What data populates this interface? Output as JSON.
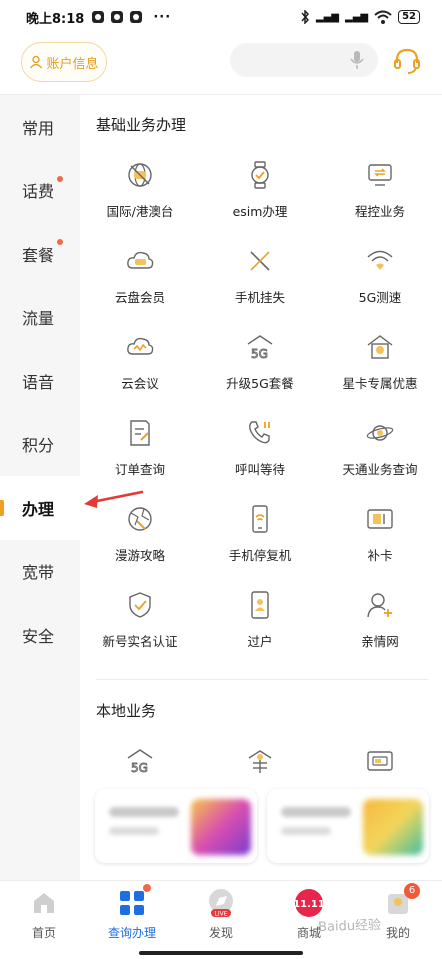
{
  "status_bar": {
    "time": "晚上8:18",
    "more": "···",
    "network": "4G",
    "battery": "52"
  },
  "header": {
    "account_label": "账户信息",
    "search_placeholder": ""
  },
  "sidebar": {
    "items": [
      {
        "label": "常用",
        "dot": false,
        "active": false
      },
      {
        "label": "话费",
        "dot": true,
        "active": false
      },
      {
        "label": "套餐",
        "dot": true,
        "active": false
      },
      {
        "label": "流量",
        "dot": false,
        "active": false
      },
      {
        "label": "语音",
        "dot": false,
        "active": false
      },
      {
        "label": "积分",
        "dot": false,
        "active": false
      },
      {
        "label": "办理",
        "dot": false,
        "active": true
      },
      {
        "label": "宽带",
        "dot": false,
        "active": false
      },
      {
        "label": "安全",
        "dot": false,
        "active": false
      }
    ]
  },
  "main": {
    "basic_title": "基础业务办理",
    "basic_items": [
      {
        "label": "国际/港澳台",
        "icon": "globe-icon"
      },
      {
        "label": "esim办理",
        "icon": "watch-icon"
      },
      {
        "label": "程控业务",
        "icon": "monitor-icon"
      },
      {
        "label": "云盘会员",
        "icon": "cloud-vip-icon"
      },
      {
        "label": "手机挂失",
        "icon": "cross-icon"
      },
      {
        "label": "5G测速",
        "icon": "wifi-speed-icon"
      },
      {
        "label": "云会议",
        "icon": "cloud-meeting-icon"
      },
      {
        "label": "升级5G套餐",
        "icon": "5g-house-icon"
      },
      {
        "label": "星卡专属优惠",
        "icon": "star-house-icon"
      },
      {
        "label": "订单查询",
        "icon": "order-doc-icon"
      },
      {
        "label": "呼叫等待",
        "icon": "phone-wait-icon"
      },
      {
        "label": "天通业务查询",
        "icon": "satellite-icon"
      },
      {
        "label": "漫游攻略",
        "icon": "roaming-icon"
      },
      {
        "label": "手机停复机",
        "icon": "mobile-icon"
      },
      {
        "label": "补卡",
        "icon": "sim-card-icon"
      },
      {
        "label": "新号实名认证",
        "icon": "shield-check-icon"
      },
      {
        "label": "过户",
        "icon": "transfer-user-icon"
      },
      {
        "label": "亲情网",
        "icon": "family-user-icon"
      }
    ],
    "local_title": "本地业务",
    "local_items": [
      {
        "icon": "5g-house-icon"
      },
      {
        "icon": "star-card-icon"
      },
      {
        "icon": "card-reader-icon"
      }
    ],
    "partial_text": "beneficial"
  },
  "bottom_nav": {
    "tabs": [
      {
        "label": "首页",
        "active": false
      },
      {
        "label": "查询办理",
        "active": true
      },
      {
        "label": "发现",
        "active": false
      },
      {
        "label": "商城",
        "active": false
      },
      {
        "label": "我的",
        "active": false
      }
    ],
    "shop_badge_text": "11.11",
    "live_badge_text": "LIVE",
    "my_badge_count": "6"
  },
  "watermark": "Baidu经验",
  "colors": {
    "accent": "#f0a020",
    "active_tab": "#1f6fe0",
    "dot": "#f06a45",
    "arrow": "#e53935"
  }
}
